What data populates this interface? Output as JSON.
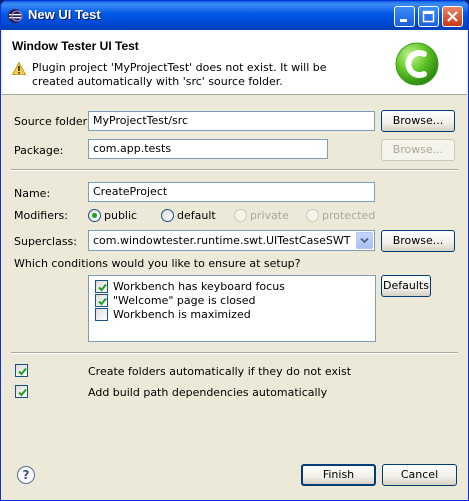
{
  "window": {
    "title": "New UI Test"
  },
  "header": {
    "title": "Window Tester UI Test",
    "message": "Plugin project 'MyProjectTest' does not exist. It will be created automatically with 'src' source folder."
  },
  "source_folder": {
    "label": "Source folder:",
    "value": "MyProjectTest/src",
    "browse_label": "Browse..."
  },
  "package": {
    "label": "Package:",
    "value": "com.app.tests",
    "browse_label": "Browse..."
  },
  "name": {
    "label": "Name:",
    "value": "CreateProject"
  },
  "modifiers": {
    "label": "Modifiers:",
    "options": [
      {
        "label": "public",
        "selected": true,
        "enabled": true
      },
      {
        "label": "default",
        "selected": false,
        "enabled": true
      },
      {
        "label": "private",
        "selected": false,
        "enabled": false
      },
      {
        "label": "protected",
        "selected": false,
        "enabled": false
      }
    ]
  },
  "superclass": {
    "label": "Superclass:",
    "value": "com.windowtester.runtime.swt.UITestCaseSWT",
    "browse_label": "Browse..."
  },
  "conditions": {
    "label": "Which conditions would you like to ensure at setup?",
    "items": [
      {
        "label": "Workbench has keyboard focus",
        "checked": true
      },
      {
        "label": "\"Welcome\" page is closed",
        "checked": true
      },
      {
        "label": "Workbench is maximized",
        "checked": false
      }
    ],
    "defaults_label": "Defaults"
  },
  "options": {
    "create_folders": {
      "label": "Create folders automatically if they do not exist",
      "checked": true
    },
    "build_path": {
      "label": "Add build path dependencies automatically",
      "checked": true
    }
  },
  "footer": {
    "finish_label": "Finish",
    "cancel_label": "Cancel",
    "help_glyph": "?"
  },
  "icons": {
    "title_icon": "eclipse-icon",
    "warning_icon": "warning-icon",
    "logo": "windowtester-logo",
    "help": "help-icon"
  },
  "colors": {
    "titlebar": "#0058e6",
    "dialog_bg": "#ece9d8",
    "logo_green": "#5fc624",
    "check_green": "#21a121"
  }
}
